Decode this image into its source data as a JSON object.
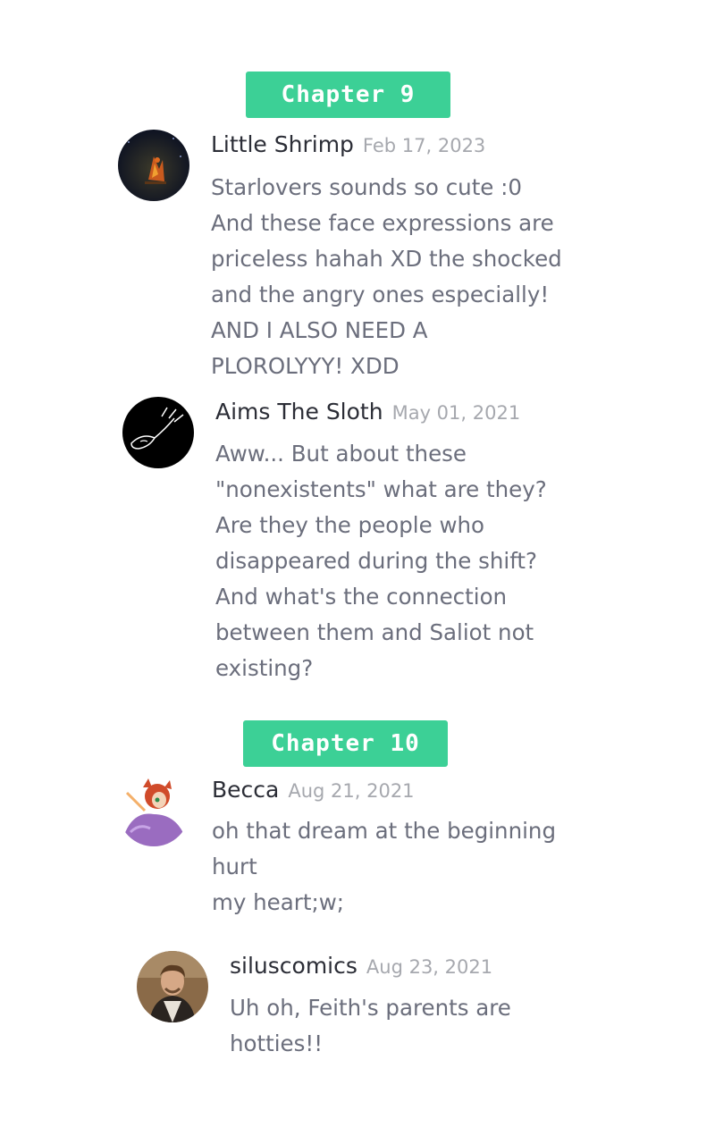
{
  "sections": [
    {
      "label": "Chapter 9",
      "comments": [
        {
          "author": "Little Shrimp",
          "date": "Feb 17, 2023",
          "avatar_icon": "fox-campfire-avatar",
          "lines": [
            "Starlovers sounds so cute :0",
            "And these face expressions are",
            "priceless hahah XD the shocked",
            "and the angry ones especially!",
            "AND I ALSO NEED A",
            "PLOROLYYY! XDD"
          ]
        },
        {
          "author": "Aims The Sloth",
          "date": "May 01, 2021",
          "avatar_icon": "sloth-sketch-avatar",
          "lines": [
            "Aww... But about these",
            "\"nonexistents\" what are they?",
            "Are they the people who",
            "disappeared during the shift?",
            "And what's the connection",
            "between them and Saliot not",
            "existing?"
          ]
        }
      ]
    },
    {
      "label": "Chapter 10",
      "comments": [
        {
          "author": "Becca",
          "date": "Aug 21, 2021",
          "avatar_icon": "cartoon-character-avatar",
          "lines": [
            "oh that dream at the beginning",
            "hurt",
            "my heart;w;"
          ]
        },
        {
          "author": "siluscomics",
          "date": "Aug 23, 2021",
          "avatar_icon": "person-photo-avatar",
          "lines": [
            "Uh oh, Feith's parents are",
            "hotties!!"
          ]
        }
      ]
    }
  ],
  "colors": {
    "badge": "#3cd096",
    "author": "#2b2d36",
    "date": "#a6a8ae",
    "text": "#6b6e7c"
  }
}
